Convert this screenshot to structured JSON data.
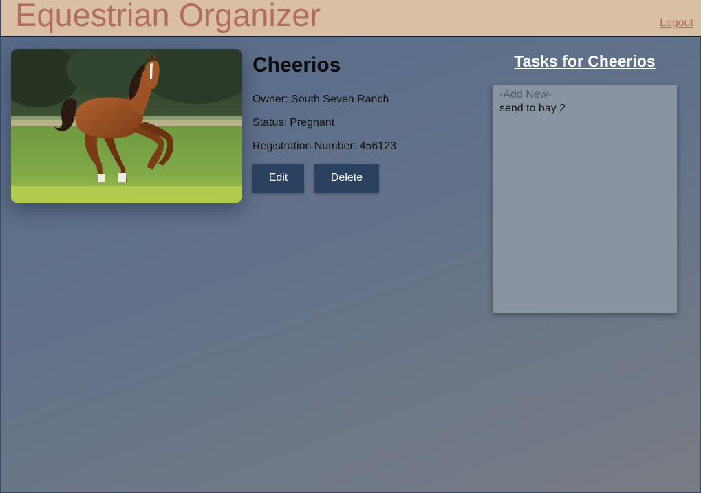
{
  "header": {
    "app_title": "Equestrian Organizer",
    "logout_label": "Logout"
  },
  "horse": {
    "name": "Cheerios",
    "owner_line": "Owner: South Seven Ranch",
    "status_line": "Status: Pregnant",
    "registration_line": "Registration Number: 456123",
    "photo_icon": "horse-photo"
  },
  "actions": {
    "edit_label": "Edit",
    "delete_label": "Delete"
  },
  "tasks": {
    "heading": "Tasks for Cheerios",
    "add_new_label": "-Add New-",
    "items": [
      {
        "label": "send to bay 2"
      }
    ]
  },
  "colors": {
    "header_bg": "#d9c0a4",
    "title_color": "#b36b61",
    "button_bg": "#2b4160",
    "tasks_box_bg": "#8a94a1"
  }
}
